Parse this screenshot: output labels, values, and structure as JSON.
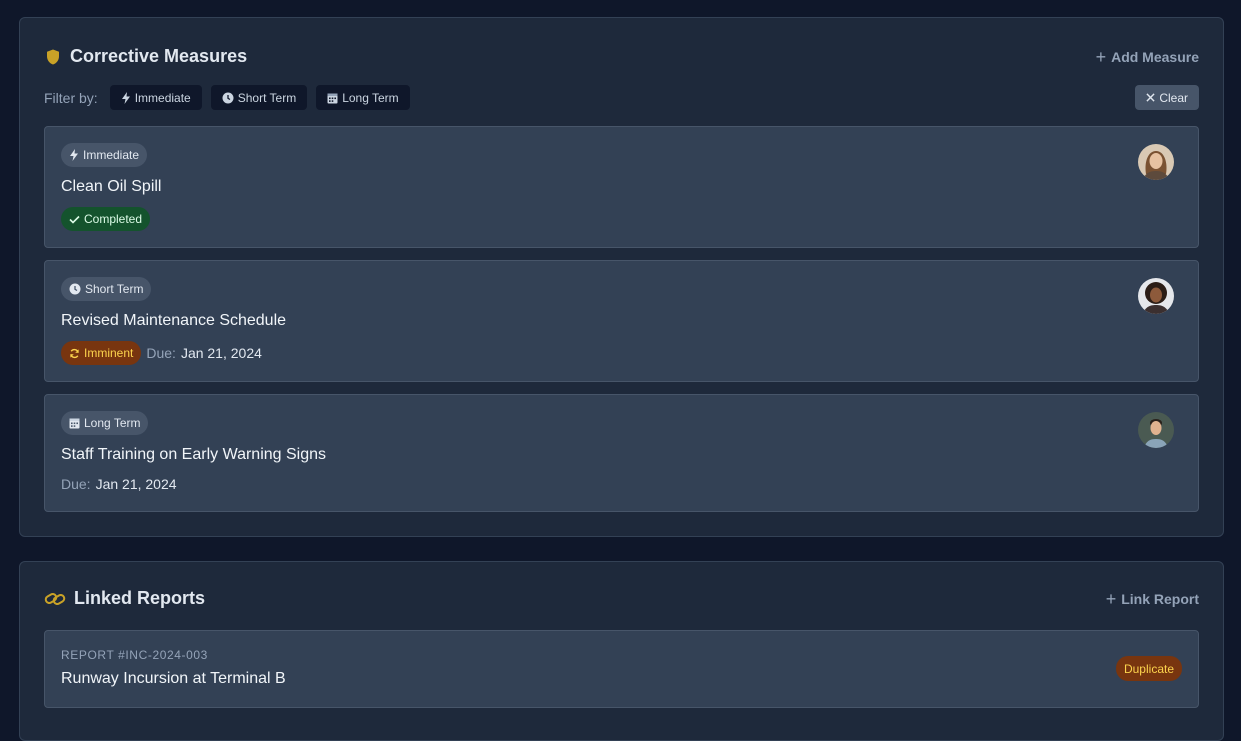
{
  "measures": {
    "title": "Corrective Measures",
    "add_label": "Add Measure",
    "filter_label": "Filter by:",
    "filters": [
      "Immediate",
      "Short Term",
      "Long Term"
    ],
    "clear_label": "Clear",
    "items": [
      {
        "type": "Immediate",
        "title": "Clean Oil Spill",
        "status": "Completed",
        "due_label": "",
        "due": ""
      },
      {
        "type": "Short Term",
        "title": "Revised Maintenance Schedule",
        "status": "Imminent",
        "due_label": "Due:",
        "due": "Jan 21, 2024"
      },
      {
        "type": "Long Term",
        "title": "Staff Training on Early Warning Signs",
        "status": "",
        "due_label": "Due:",
        "due": "Jan 21, 2024"
      }
    ]
  },
  "reports": {
    "title": "Linked Reports",
    "link_label": "Link Report",
    "items": [
      {
        "id": "REPORT #INC-2024-003",
        "title": "Runway Incursion at Terminal B",
        "badge": "Duplicate"
      }
    ]
  },
  "colors": {
    "accent_gold": "#c9a227",
    "completed_bg": "#14532d",
    "imminent_bg": "#78350f",
    "duplicate_bg": "#78350f"
  }
}
